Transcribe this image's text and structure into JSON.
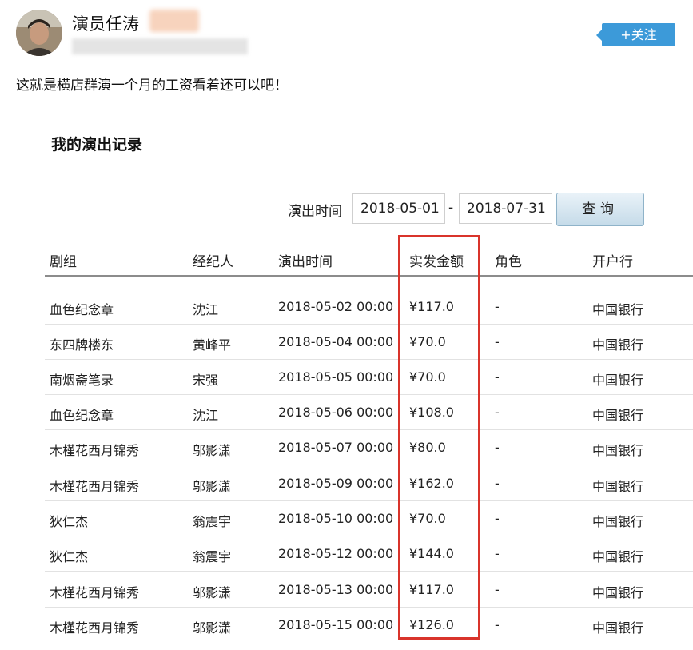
{
  "post": {
    "author": "演员任涛",
    "follow_label": "+关注",
    "text": "这就是横店群演一个月的工资看着还可以吧！"
  },
  "panel": {
    "title": "我的演出记录",
    "filter_label": "演出时间",
    "date_from": "2018-05-01",
    "date_sep": "-",
    "date_to": "2018-07-31",
    "query_label": "查询"
  },
  "table": {
    "headers": [
      "剧组",
      "经纪人",
      "演出时间",
      "实发金额",
      "角色",
      "开户行"
    ],
    "rows": [
      {
        "crew": "血色纪念章",
        "agent": "沈江",
        "time": "2018-05-02 00:00",
        "amount": "¥117.0",
        "role": "-",
        "bank": "中国银行"
      },
      {
        "crew": "东四牌楼东",
        "agent": "黄峰平",
        "time": "2018-05-04 00:00",
        "amount": "¥70.0",
        "role": "-",
        "bank": "中国银行"
      },
      {
        "crew": "南烟斋笔录",
        "agent": "宋强",
        "time": "2018-05-05 00:00",
        "amount": "¥70.0",
        "role": "-",
        "bank": "中国银行"
      },
      {
        "crew": "血色纪念章",
        "agent": "沈江",
        "time": "2018-05-06 00:00",
        "amount": "¥108.0",
        "role": "-",
        "bank": "中国银行"
      },
      {
        "crew": "木槿花西月锦秀",
        "agent": "邬影潇",
        "time": "2018-05-07 00:00",
        "amount": "¥80.0",
        "role": "-",
        "bank": "中国银行"
      },
      {
        "crew": "木槿花西月锦秀",
        "agent": "邬影潇",
        "time": "2018-05-09 00:00",
        "amount": "¥162.0",
        "role": "-",
        "bank": "中国银行"
      },
      {
        "crew": "狄仁杰",
        "agent": "翁震宇",
        "time": "2018-05-10 00:00",
        "amount": "¥70.0",
        "role": "-",
        "bank": "中国银行"
      },
      {
        "crew": "狄仁杰",
        "agent": "翁震宇",
        "time": "2018-05-12 00:00",
        "amount": "¥144.0",
        "role": "-",
        "bank": "中国银行"
      },
      {
        "crew": "木槿花西月锦秀",
        "agent": "邬影潇",
        "time": "2018-05-13 00:00",
        "amount": "¥117.0",
        "role": "-",
        "bank": "中国银行"
      },
      {
        "crew": "木槿花西月锦秀",
        "agent": "邬影潇",
        "time": "2018-05-15 00:00",
        "amount": "¥126.0",
        "role": "-",
        "bank": "中国银行"
      }
    ]
  },
  "colors": {
    "follow_button": "#3c9ad9",
    "highlight_box": "#d9342b",
    "query_button": "#c5dbe9"
  }
}
